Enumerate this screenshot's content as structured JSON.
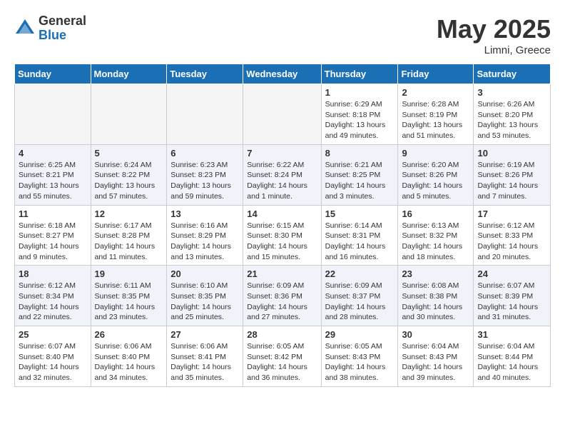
{
  "header": {
    "logo_general": "General",
    "logo_blue": "Blue",
    "month_title": "May 2025",
    "location": "Limni, Greece"
  },
  "weekdays": [
    "Sunday",
    "Monday",
    "Tuesday",
    "Wednesday",
    "Thursday",
    "Friday",
    "Saturday"
  ],
  "weeks": [
    [
      {
        "day": "",
        "info": ""
      },
      {
        "day": "",
        "info": ""
      },
      {
        "day": "",
        "info": ""
      },
      {
        "day": "",
        "info": ""
      },
      {
        "day": "1",
        "info": "Sunrise: 6:29 AM\nSunset: 8:18 PM\nDaylight: 13 hours\nand 49 minutes."
      },
      {
        "day": "2",
        "info": "Sunrise: 6:28 AM\nSunset: 8:19 PM\nDaylight: 13 hours\nand 51 minutes."
      },
      {
        "day": "3",
        "info": "Sunrise: 6:26 AM\nSunset: 8:20 PM\nDaylight: 13 hours\nand 53 minutes."
      }
    ],
    [
      {
        "day": "4",
        "info": "Sunrise: 6:25 AM\nSunset: 8:21 PM\nDaylight: 13 hours\nand 55 minutes."
      },
      {
        "day": "5",
        "info": "Sunrise: 6:24 AM\nSunset: 8:22 PM\nDaylight: 13 hours\nand 57 minutes."
      },
      {
        "day": "6",
        "info": "Sunrise: 6:23 AM\nSunset: 8:23 PM\nDaylight: 13 hours\nand 59 minutes."
      },
      {
        "day": "7",
        "info": "Sunrise: 6:22 AM\nSunset: 8:24 PM\nDaylight: 14 hours\nand 1 minute."
      },
      {
        "day": "8",
        "info": "Sunrise: 6:21 AM\nSunset: 8:25 PM\nDaylight: 14 hours\nand 3 minutes."
      },
      {
        "day": "9",
        "info": "Sunrise: 6:20 AM\nSunset: 8:26 PM\nDaylight: 14 hours\nand 5 minutes."
      },
      {
        "day": "10",
        "info": "Sunrise: 6:19 AM\nSunset: 8:26 PM\nDaylight: 14 hours\nand 7 minutes."
      }
    ],
    [
      {
        "day": "11",
        "info": "Sunrise: 6:18 AM\nSunset: 8:27 PM\nDaylight: 14 hours\nand 9 minutes."
      },
      {
        "day": "12",
        "info": "Sunrise: 6:17 AM\nSunset: 8:28 PM\nDaylight: 14 hours\nand 11 minutes."
      },
      {
        "day": "13",
        "info": "Sunrise: 6:16 AM\nSunset: 8:29 PM\nDaylight: 14 hours\nand 13 minutes."
      },
      {
        "day": "14",
        "info": "Sunrise: 6:15 AM\nSunset: 8:30 PM\nDaylight: 14 hours\nand 15 minutes."
      },
      {
        "day": "15",
        "info": "Sunrise: 6:14 AM\nSunset: 8:31 PM\nDaylight: 14 hours\nand 16 minutes."
      },
      {
        "day": "16",
        "info": "Sunrise: 6:13 AM\nSunset: 8:32 PM\nDaylight: 14 hours\nand 18 minutes."
      },
      {
        "day": "17",
        "info": "Sunrise: 6:12 AM\nSunset: 8:33 PM\nDaylight: 14 hours\nand 20 minutes."
      }
    ],
    [
      {
        "day": "18",
        "info": "Sunrise: 6:12 AM\nSunset: 8:34 PM\nDaylight: 14 hours\nand 22 minutes."
      },
      {
        "day": "19",
        "info": "Sunrise: 6:11 AM\nSunset: 8:35 PM\nDaylight: 14 hours\nand 23 minutes."
      },
      {
        "day": "20",
        "info": "Sunrise: 6:10 AM\nSunset: 8:35 PM\nDaylight: 14 hours\nand 25 minutes."
      },
      {
        "day": "21",
        "info": "Sunrise: 6:09 AM\nSunset: 8:36 PM\nDaylight: 14 hours\nand 27 minutes."
      },
      {
        "day": "22",
        "info": "Sunrise: 6:09 AM\nSunset: 8:37 PM\nDaylight: 14 hours\nand 28 minutes."
      },
      {
        "day": "23",
        "info": "Sunrise: 6:08 AM\nSunset: 8:38 PM\nDaylight: 14 hours\nand 30 minutes."
      },
      {
        "day": "24",
        "info": "Sunrise: 6:07 AM\nSunset: 8:39 PM\nDaylight: 14 hours\nand 31 minutes."
      }
    ],
    [
      {
        "day": "25",
        "info": "Sunrise: 6:07 AM\nSunset: 8:40 PM\nDaylight: 14 hours\nand 32 minutes."
      },
      {
        "day": "26",
        "info": "Sunrise: 6:06 AM\nSunset: 8:40 PM\nDaylight: 14 hours\nand 34 minutes."
      },
      {
        "day": "27",
        "info": "Sunrise: 6:06 AM\nSunset: 8:41 PM\nDaylight: 14 hours\nand 35 minutes."
      },
      {
        "day": "28",
        "info": "Sunrise: 6:05 AM\nSunset: 8:42 PM\nDaylight: 14 hours\nand 36 minutes."
      },
      {
        "day": "29",
        "info": "Sunrise: 6:05 AM\nSunset: 8:43 PM\nDaylight: 14 hours\nand 38 minutes."
      },
      {
        "day": "30",
        "info": "Sunrise: 6:04 AM\nSunset: 8:43 PM\nDaylight: 14 hours\nand 39 minutes."
      },
      {
        "day": "31",
        "info": "Sunrise: 6:04 AM\nSunset: 8:44 PM\nDaylight: 14 hours\nand 40 minutes."
      }
    ]
  ]
}
